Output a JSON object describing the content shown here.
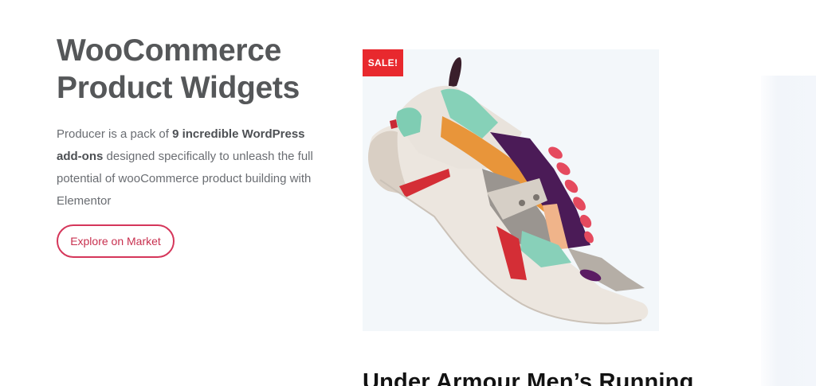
{
  "hero": {
    "title_line1": "WooCommerce",
    "title_line2": "Product Widgets",
    "desc_part1": "Producer is a pack of ",
    "desc_bold1": "9 incredible WordPress",
    "desc_bold2": "add-ons",
    "desc_part2": " designed specifically to unleash the full potential of wooCommerce product building with Elementor",
    "button_label": "Explore on Market"
  },
  "product": {
    "sale_badge": "SALE!",
    "image_icon": "sneaker-image",
    "title": "Under Armour Men’s Running"
  },
  "colors": {
    "heading": "#555759",
    "body_text": "#6a6d72",
    "accent": "#d5365a",
    "sale_red": "#e8292e",
    "image_bg": "#f3f7fa"
  }
}
